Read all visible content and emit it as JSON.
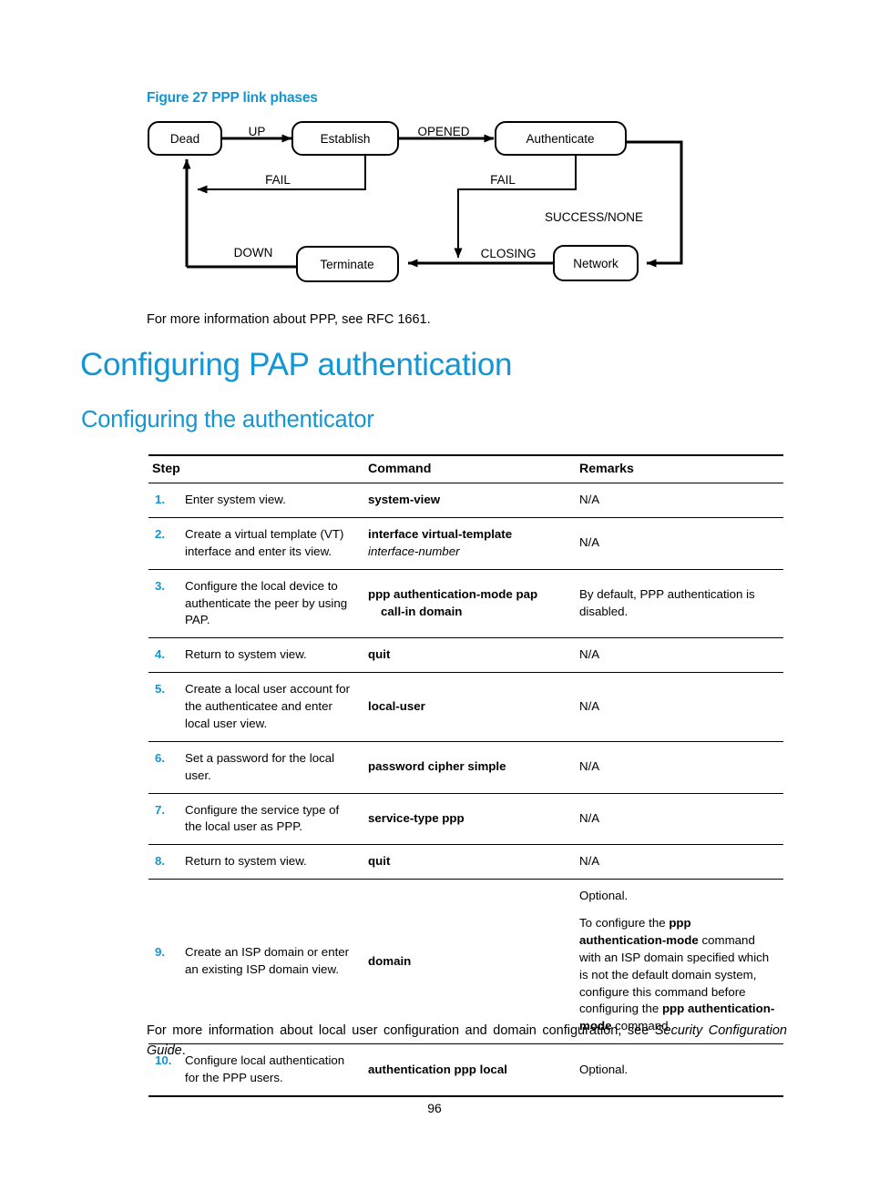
{
  "figure": {
    "caption": "Figure 27 PPP link phases",
    "nodes": {
      "dead": "Dead",
      "establish": "Establish",
      "authenticate": "Authenticate",
      "network": "Network",
      "terminate": "Terminate"
    },
    "edges": {
      "up": "UP",
      "opened": "OPENED",
      "fail_establish": "FAIL",
      "fail_authenticate": "FAIL",
      "success_none": "SUCCESS/NONE",
      "closing": "CLOSING",
      "down": "DOWN"
    }
  },
  "paragraphs": {
    "rfc_note": "For more information about PPP, see RFC 1661.",
    "footer_lead": "For more information about local user configuration and domain configuration, see ",
    "footer_italic": "Security Configuration Guide",
    "footer_tail": "."
  },
  "headings": {
    "main": "Configuring PAP authentication",
    "sub": "Configuring the authenticator"
  },
  "table": {
    "headers": [
      "Step",
      "Command",
      "Remarks"
    ],
    "rows": [
      {
        "num": "1.",
        "step": "Enter system view.",
        "command": "system-view",
        "command_param": "",
        "command_line2": "",
        "remarks": [
          "N/A"
        ]
      },
      {
        "num": "2.",
        "step": "Create a virtual template (VT) interface and enter its view.",
        "command": "interface virtual-template",
        "command_param": "interface-number",
        "command_line2": "",
        "remarks": [
          "N/A"
        ]
      },
      {
        "num": "3.",
        "step": "Configure the local device to authenticate the peer by using PAP.",
        "command": "ppp authentication-mode pap",
        "command_param": "",
        "command_line2": "call-in   domain",
        "remarks": [
          "By default, PPP authentication is disabled."
        ]
      },
      {
        "num": "4.",
        "step": "Return to system view.",
        "command": "quit",
        "command_param": "",
        "command_line2": "",
        "remarks": [
          "N/A"
        ]
      },
      {
        "num": "5.",
        "step": "Create a local user account for the authenticatee and enter local user view.",
        "command": "local-user",
        "command_param": "",
        "command_line2": "",
        "remarks": [
          "N/A"
        ]
      },
      {
        "num": "6.",
        "step": "Set a password for the local user.",
        "command": "password   cipher   simple",
        "command_param": "",
        "command_line2": "",
        "remarks": [
          "N/A"
        ]
      },
      {
        "num": "7.",
        "step": "Configure the service type of the local user as PPP.",
        "command": "service-type ppp",
        "command_param": "",
        "command_line2": "",
        "remarks": [
          "N/A"
        ]
      },
      {
        "num": "8.",
        "step": "Return to system view.",
        "command": "quit",
        "command_param": "",
        "command_line2": "",
        "remarks": [
          "N/A"
        ]
      },
      {
        "num": "9.",
        "step": "Create an ISP domain or enter an existing ISP domain view.",
        "command": "domain",
        "command_param": "",
        "command_line2": "",
        "remarks": [
          "Optional."
        ],
        "remarks_rich": true
      },
      {
        "num": "10.",
        "step": "Configure local authentication for the PPP users.",
        "command": "authentication ppp local",
        "command_param": "",
        "command_line2": "",
        "remarks": [
          "Optional."
        ]
      }
    ],
    "row9_remark_optional": "Optional.",
    "row9_remark_parts": {
      "a": "To configure the ",
      "b": "ppp authentication-mode",
      "c": " command with an ISP domain specified which is not the default domain system, configure this command before configuring the ",
      "d": "ppp authentication-mode",
      "e": " command."
    }
  },
  "page_number": "96",
  "colors": {
    "heading_blue": "#1296d4",
    "text_black": "#000000"
  }
}
